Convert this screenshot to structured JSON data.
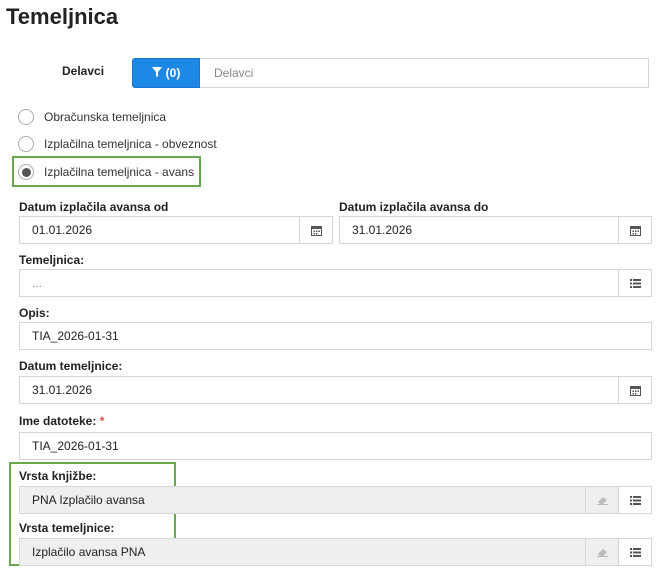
{
  "page": {
    "title": "Temeljnica"
  },
  "delavci": {
    "label": "Delavci",
    "filter_label": "(0)",
    "placeholder": "Delavci"
  },
  "radios": [
    {
      "label": "Obračunska temeljnica",
      "selected": false
    },
    {
      "label": "Izplačilna temeljnica - obveznost",
      "selected": false
    },
    {
      "label": "Izplačilna temeljnica - avans",
      "selected": true
    }
  ],
  "form": {
    "date_from": {
      "label": "Datum izplačila avansa od",
      "value": "01.01.2026"
    },
    "date_to": {
      "label": "Datum izplačila avansa do",
      "value": "31.01.2026"
    },
    "temeljnica": {
      "label": "Temeljnica:",
      "placeholder": "..."
    },
    "opis": {
      "label": "Opis:",
      "value": "TIA_2026-01-31"
    },
    "datum_temeljnice": {
      "label": "Datum temeljnice:",
      "value": "31.01.2026"
    },
    "ime_datoteke": {
      "label": "Ime datoteke:",
      "required_mark": "*",
      "value": "TIA_2026-01-31"
    },
    "vrsta_knjizbe": {
      "label": "Vrsta knjižbe:",
      "value": "PNA Izplačilo avansa"
    },
    "vrsta_temeljnice": {
      "label": "Vrsta temeljnice:",
      "value": "Izplačilo avansa PNA"
    }
  },
  "icons": {
    "filter": "filter-icon",
    "calendar": "calendar-icon",
    "list": "list-icon",
    "eraser": "eraser-icon"
  },
  "colors": {
    "accent": "#1e88e5",
    "highlight": "#6aa84f"
  }
}
